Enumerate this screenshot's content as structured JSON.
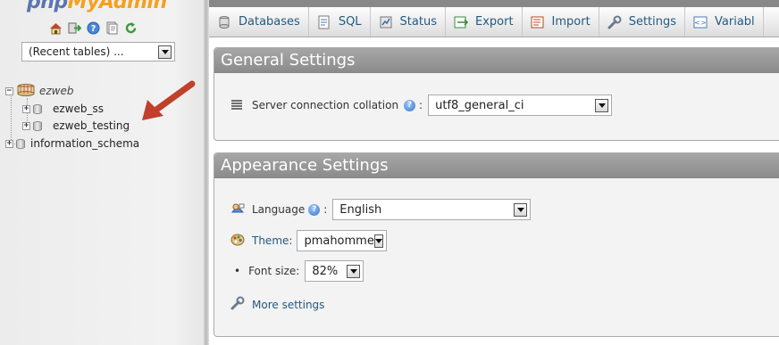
{
  "nav": {
    "logo": {
      "php": "php",
      "rest": "MyAdmin"
    },
    "quick_icons": [
      "home-icon",
      "logout-icon",
      "help-icon",
      "docs-icon",
      "reload-icon"
    ],
    "recent_tables": "(Recent tables) ...",
    "tree": [
      {
        "name": "ezweb",
        "expanded": true,
        "italic": true,
        "children": [
          {
            "name": "ezweb_ss"
          },
          {
            "name": "ezweb_testing"
          }
        ]
      },
      {
        "name": "information_schema",
        "expanded": false
      }
    ]
  },
  "tabs": [
    {
      "label": "Databases",
      "icon": "database-icon"
    },
    {
      "label": "SQL",
      "icon": "sql-icon"
    },
    {
      "label": "Status",
      "icon": "status-icon"
    },
    {
      "label": "Export",
      "icon": "export-icon"
    },
    {
      "label": "Import",
      "icon": "import-icon"
    },
    {
      "label": "Settings",
      "icon": "wrench-icon"
    },
    {
      "label": "Variabl",
      "icon": "variables-icon"
    }
  ],
  "general": {
    "title": "General Settings",
    "collation_label": "Server connection collation",
    "collation_value": "utf8_general_ci",
    "separator": ":"
  },
  "appearance": {
    "title": "Appearance Settings",
    "language_label": "Language",
    "language_value": "English",
    "theme_label": "Theme:",
    "theme_value": "pmahomme",
    "fontsize_label": "Font size:",
    "fontsize_value": "82%",
    "more_settings": "More settings",
    "separator": ":"
  },
  "colors": {
    "link": "#235a81",
    "arrow": "#c0402a",
    "header": "#969696"
  }
}
